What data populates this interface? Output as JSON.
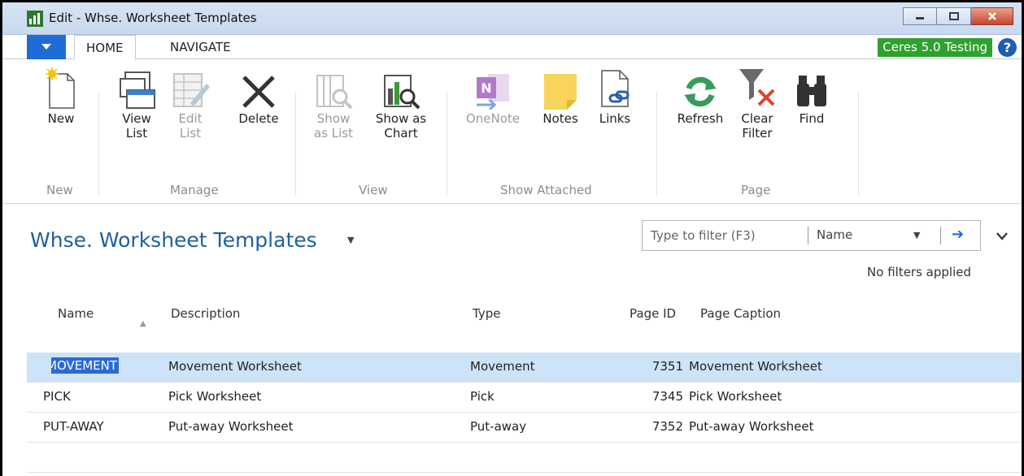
{
  "window": {
    "title": "Edit - Whse. Worksheet Templates"
  },
  "tabs": [
    {
      "label": "HOME",
      "active": true
    },
    {
      "label": "NAVIGATE",
      "active": false
    }
  ],
  "environment_badge": "Ceres 5.0 Testing",
  "ribbon": {
    "groups": [
      {
        "label": "New",
        "buttons": [
          {
            "label": "New",
            "icon": "new-document-icon",
            "enabled": true
          }
        ]
      },
      {
        "label": "Manage",
        "buttons": [
          {
            "label": "View\nList",
            "icon": "view-list-icon",
            "enabled": true
          },
          {
            "label": "Edit\nList",
            "icon": "edit-list-icon",
            "enabled": false
          },
          {
            "label": "Delete",
            "icon": "delete-icon",
            "enabled": true
          }
        ]
      },
      {
        "label": "View",
        "buttons": [
          {
            "label": "Show\nas List",
            "icon": "show-as-list-icon",
            "enabled": false
          },
          {
            "label": "Show as\nChart",
            "icon": "show-as-chart-icon",
            "enabled": true
          }
        ]
      },
      {
        "label": "Show Attached",
        "buttons": [
          {
            "label": "OneNote",
            "icon": "onenote-icon",
            "enabled": false
          },
          {
            "label": "Notes",
            "icon": "notes-icon",
            "enabled": true
          },
          {
            "label": "Links",
            "icon": "links-icon",
            "enabled": true
          }
        ]
      },
      {
        "label": "Page",
        "buttons": [
          {
            "label": "Refresh",
            "icon": "refresh-icon",
            "enabled": true
          },
          {
            "label": "Clear\nFilter",
            "icon": "clear-filter-icon",
            "enabled": true
          },
          {
            "label": "Find",
            "icon": "binoculars-icon",
            "enabled": true
          }
        ]
      }
    ]
  },
  "page": {
    "title": "Whse. Worksheet Templates",
    "filter": {
      "placeholder": "Type to filter (F3)",
      "field": "Name"
    },
    "filter_status": "No filters applied"
  },
  "table": {
    "columns": [
      "Name",
      "Description",
      "Type",
      "Page ID",
      "Page Caption"
    ],
    "sort_column": "Name",
    "rows": [
      {
        "name": "MOVEMENT",
        "description": "Movement Worksheet",
        "type": "Movement",
        "page_id": "7351",
        "page_caption": "Movement Worksheet",
        "selected": true
      },
      {
        "name": "PICK",
        "description": "Pick Worksheet",
        "type": "Pick",
        "page_id": "7345",
        "page_caption": "Pick Worksheet",
        "selected": false
      },
      {
        "name": "PUT-AWAY",
        "description": "Put-away Worksheet",
        "type": "Put-away",
        "page_id": "7352",
        "page_caption": "Put-away Worksheet",
        "selected": false
      }
    ]
  },
  "colors": {
    "accent": "#1e6cd4",
    "title": "#1f5f9f",
    "badge": "#2fa12f",
    "selected_row": "#cde3f7"
  }
}
